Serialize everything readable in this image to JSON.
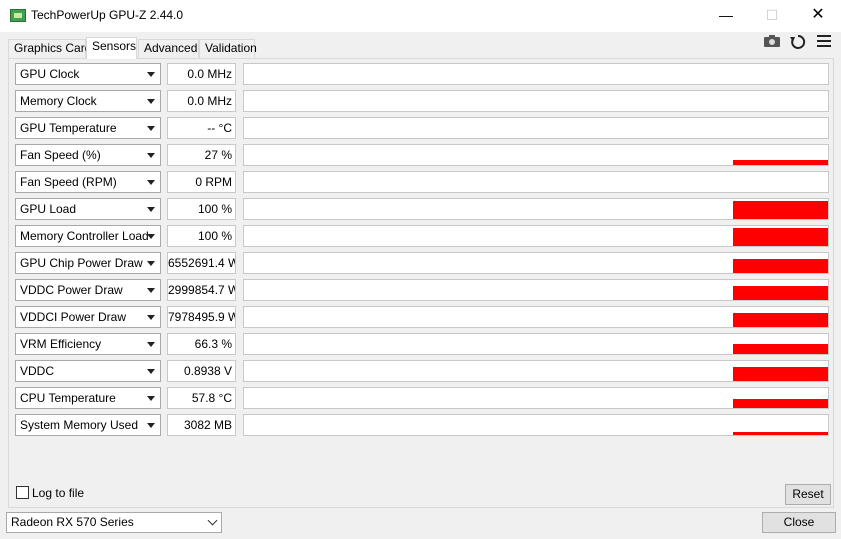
{
  "window": {
    "title": "TechPowerUp GPU-Z 2.44.0",
    "minimize_glyph": "—",
    "maximize_glyph": "☐",
    "close_glyph": "✕"
  },
  "tabs": [
    {
      "label": "Graphics Card",
      "active": false
    },
    {
      "label": "Sensors",
      "active": true
    },
    {
      "label": "Advanced",
      "active": false
    },
    {
      "label": "Validation",
      "active": false
    }
  ],
  "toolbar": {
    "camera_icon": "camera-icon",
    "refresh_icon": "refresh-icon",
    "menu_icon": "hamburger-menu-icon"
  },
  "colors": {
    "graph_bar": "#ff0000"
  },
  "sensors": [
    {
      "name": "GPU Clock",
      "value": "0.0 MHz",
      "level": 0
    },
    {
      "name": "Memory Clock",
      "value": "0.0 MHz",
      "level": 0
    },
    {
      "name": "GPU Temperature",
      "value": "-- °C",
      "level": 0
    },
    {
      "name": "Fan Speed (%)",
      "value": "27 %",
      "level": 0.27
    },
    {
      "name": "Fan Speed (RPM)",
      "value": "0 RPM",
      "level": 0
    },
    {
      "name": "GPU Load",
      "value": "100 %",
      "level": 1.0
    },
    {
      "name": "Memory Controller Load",
      "value": "100 %",
      "level": 1.0
    },
    {
      "name": "GPU Chip Power Draw",
      "value": "6552691.4 W",
      "level": 0.75
    },
    {
      "name": "VDDC Power Draw",
      "value": "2999854.7 W",
      "level": 0.75
    },
    {
      "name": "VDDCI Power Draw",
      "value": "7978495.9 W",
      "level": 0.75
    },
    {
      "name": "VRM Efficiency",
      "value": "66.3 %",
      "level": 0.55
    },
    {
      "name": "VDDC",
      "value": "0.8938 V",
      "level": 0.75
    },
    {
      "name": "CPU Temperature",
      "value": "57.8 °C",
      "level": 0.5
    },
    {
      "name": "System Memory Used",
      "value": "3082 MB",
      "level": 0.15
    }
  ],
  "footer": {
    "log_to_file_label": "Log to file",
    "log_to_file_checked": false,
    "reset_label": "Reset",
    "gpu_selected": "Radeon RX 570 Series",
    "close_label": "Close"
  }
}
